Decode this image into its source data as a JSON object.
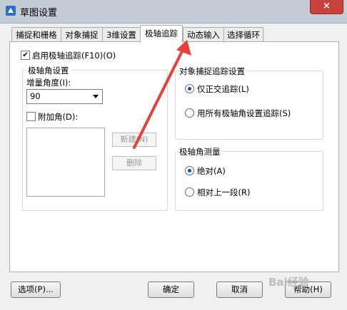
{
  "window": {
    "title": "草图设置",
    "close_icon": "×"
  },
  "tabs": [
    {
      "label": "捕捉和栅格"
    },
    {
      "label": "对象捕捉"
    },
    {
      "label": "3维设置"
    },
    {
      "label": "极轴追踪"
    },
    {
      "label": "动态输入"
    },
    {
      "label": "选择循环"
    }
  ],
  "polar": {
    "enable_label": "启用极轴追踪(F10)(O)",
    "enable_checked": true,
    "angle_group_title": "极轴角设置",
    "increment_label": "增量角度(I):",
    "increment_value": "90",
    "additional_label": "附加角(D):",
    "new_button": "新建(N)",
    "delete_button": "删除"
  },
  "snap_tracking": {
    "title": "对象捕捉追踪设置",
    "option_ortho": "仅正交追踪(L)",
    "option_all": "用所有极轴角设置追踪(S)",
    "selected": "ortho"
  },
  "measurement": {
    "title": "极轴角测量",
    "option_absolute": "绝对(A)",
    "option_relative": "相对上一段(R)",
    "selected": "absolute"
  },
  "footer": {
    "options_button": "选项(P)...",
    "ok_button": "确定",
    "cancel_button": "取消",
    "help_button": "帮助(H)"
  },
  "annotation": {
    "arrow_color": "#e8413a"
  },
  "watermark": "Bai经验"
}
